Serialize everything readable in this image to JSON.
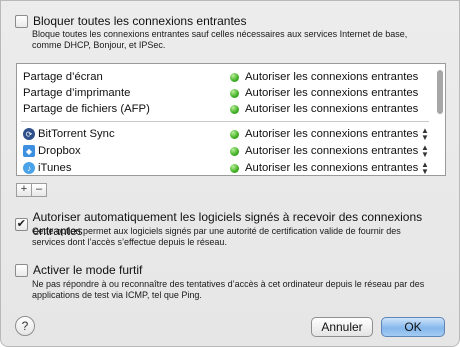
{
  "block_all": {
    "checked": false,
    "label": "Bloquer toutes les connexions entrantes",
    "description_line1": "Bloque toutes les connexions entrantes sauf celles nécessaires aux services Internet de base,",
    "description_line2": "comme DHCP, Bonjour, et IPSec."
  },
  "services": [
    {
      "name": "Partage d’écran",
      "status": "Autoriser les connexions entrantes"
    },
    {
      "name": "Partage d’imprimante",
      "status": "Autoriser les connexions entrantes"
    },
    {
      "name": "Partage de fichiers (AFP)",
      "status": "Autoriser les connexions entrantes"
    }
  ],
  "apps": [
    {
      "name": "BitTorrent Sync",
      "status": "Autoriser les connexions entrantes",
      "icon": "bittorrent-sync-icon"
    },
    {
      "name": "Dropbox",
      "status": "Autoriser les connexions entrantes",
      "icon": "dropbox-icon"
    },
    {
      "name": "iTunes",
      "status": "Autoriser les connexions entrantes",
      "icon": "itunes-icon"
    }
  ],
  "list_buttons": {
    "add": "+",
    "remove": "–"
  },
  "signed_apps": {
    "checked": true,
    "label": "Autoriser automatiquement les logiciels signés à recevoir des connexions entrantes",
    "description_line1": "Cette option permet aux logiciels signés par une autorité de certification valide de fournir des",
    "description_line2": "services dont l’accès s’effectue depuis le réseau."
  },
  "stealth": {
    "checked": false,
    "label": "Activer le mode furtif",
    "description_line1": "Ne pas répondre à ou reconnaître des tentatives d’accès à cet ordinateur depuis le réseau par des",
    "description_line2": "applications de test via ICMP, tel que Ping."
  },
  "buttons": {
    "help": "?",
    "cancel": "Annuler",
    "ok": "OK"
  },
  "colors": {
    "status_green": "#3fae21",
    "default_button": "#86b8ec"
  }
}
